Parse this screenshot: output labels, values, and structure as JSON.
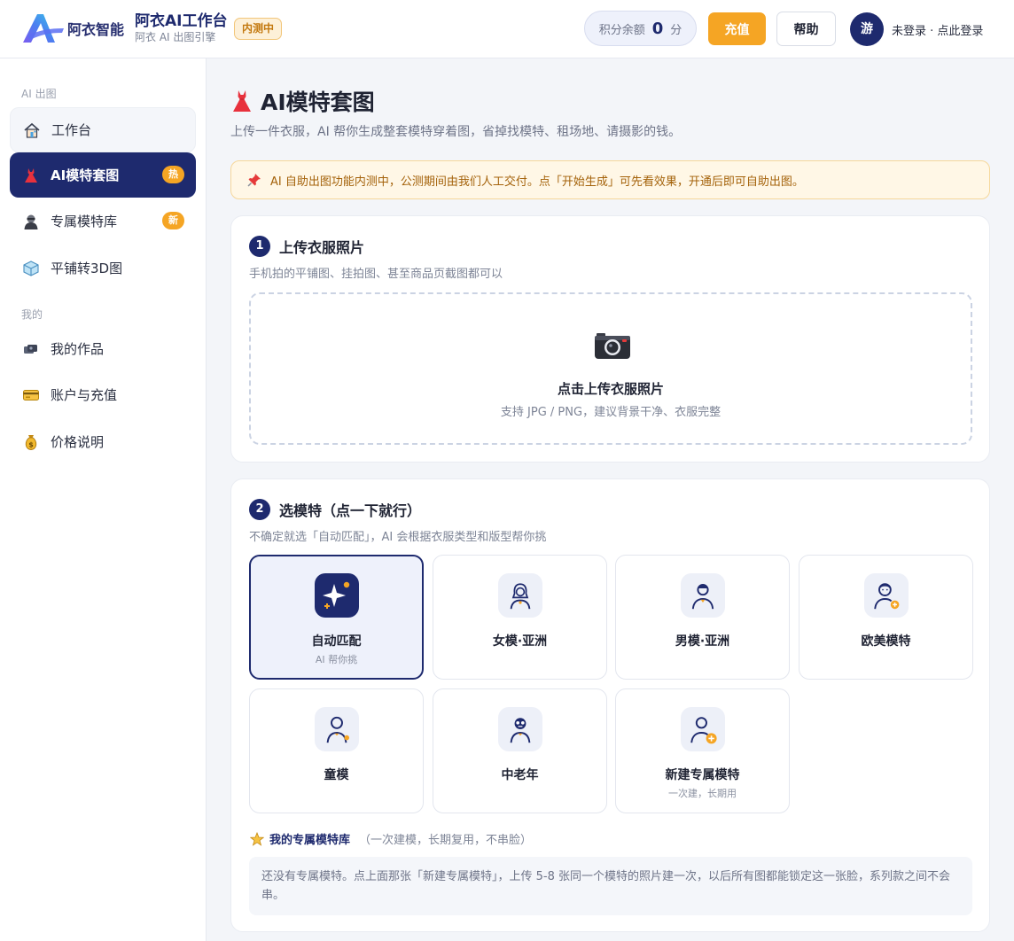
{
  "header": {
    "logo_text": "阿衣智能",
    "product_title": "阿衣AI工作台",
    "product_subtitle": "阿衣 AI 出图引擎",
    "beta_tag": "内测中",
    "points_label": "积分余额",
    "points_value": "0",
    "points_unit": "分",
    "recharge_label": "充值",
    "help_label": "帮助",
    "avatar_text": "游",
    "login_text": "未登录 · 点此登录"
  },
  "sidebar": {
    "section_ai": "AI 出图",
    "section_mine": "我的",
    "items": [
      {
        "label": "工作台",
        "icon": "house-icon"
      },
      {
        "label": "AI模特套图",
        "icon": "dress-icon",
        "badge": "热"
      },
      {
        "label": "专属模特库",
        "icon": "person-icon",
        "badge": "新"
      },
      {
        "label": "平铺转3D图",
        "icon": "cube-icon"
      },
      {
        "label": "我的作品",
        "icon": "photos-icon"
      },
      {
        "label": "账户与充值",
        "icon": "card-icon"
      },
      {
        "label": "价格说明",
        "icon": "money-bag-icon"
      }
    ]
  },
  "main": {
    "title": "AI模特套图",
    "subtitle": "上传一件衣服，AI 帮你生成整套模特穿着图，省掉找模特、租场地、请摄影的钱。",
    "notice": "AI 自助出图功能内测中，公测期间由我们人工交付。点「开始生成」可先看效果，开通后即可自助出图。",
    "step1": {
      "num": "1",
      "title": "上传衣服照片",
      "desc": "手机拍的平铺图、挂拍图、甚至商品页截图都可以",
      "upload_title": "点击上传衣服照片",
      "upload_hint": "支持 JPG / PNG，建议背景干净、衣服完整"
    },
    "step2": {
      "num": "2",
      "title": "选模特（点一下就行）",
      "desc": "不确定就选「自动匹配」，AI 会根据衣服类型和版型帮你挑",
      "models": [
        {
          "name": "自动匹配",
          "sub": "AI 帮你挑",
          "selected": true
        },
        {
          "name": "女模·亚洲",
          "sub": ""
        },
        {
          "name": "男模·亚洲",
          "sub": ""
        },
        {
          "name": "欧美模特",
          "sub": ""
        },
        {
          "name": "童模",
          "sub": ""
        },
        {
          "name": "中老年",
          "sub": ""
        },
        {
          "name": "新建专属模特",
          "sub": "一次建，长期用"
        }
      ],
      "library_title": "我的专属模特库",
      "library_note": "（一次建模，长期复用，不串脸）",
      "library_empty": "还没有专属模特。点上面那张「新建专属模特」，上传 5-8 张同一个模特的照片建一次，以后所有图都能锁定这一张脸，系列款之间不会串。"
    }
  },
  "colors": {
    "brand": "#1e2a6e",
    "accent": "#f5a524",
    "notice_bg": "#fff7e6"
  }
}
